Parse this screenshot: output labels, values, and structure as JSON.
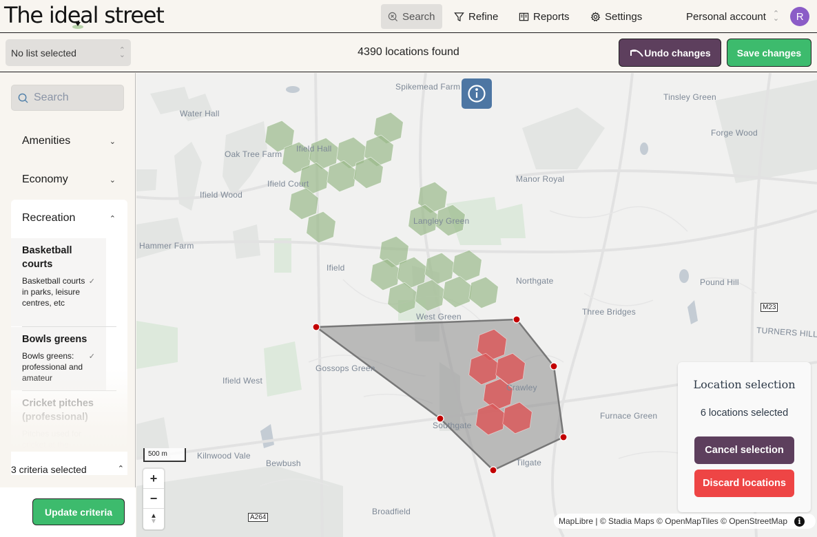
{
  "app": {
    "title": "The ideal street",
    "nav": [
      {
        "label": "Search",
        "icon": "search-x-icon",
        "active": true
      },
      {
        "label": "Refine",
        "icon": "filter-icon",
        "active": false
      },
      {
        "label": "Reports",
        "icon": "book-icon",
        "active": false
      },
      {
        "label": "Settings",
        "icon": "gear-icon",
        "active": false
      }
    ],
    "account": {
      "label": "Personal account",
      "avatar_letter": "R",
      "avatar_color": "#8b5cc7"
    }
  },
  "toolbar": {
    "list_select": "No list selected",
    "locations_found": "4390 locations found",
    "undo_label": "Undo changes",
    "save_label": "Save changes"
  },
  "sidebar": {
    "search_placeholder": "Search",
    "categories": [
      {
        "label": "Amenities",
        "expanded": false
      },
      {
        "label": "Economy",
        "expanded": false
      },
      {
        "label": "Recreation",
        "expanded": true
      }
    ],
    "criteria": [
      {
        "title": "Basketball courts",
        "description": "Basketball courts in parks, leisure centres, etc",
        "selected": true
      },
      {
        "title": "Bowls greens",
        "description": "Bowls greens: professional and amateur",
        "selected": true
      },
      {
        "title": "Cricket pitches (professional)",
        "description": "Pitches used for cricket at the",
        "selected": false
      }
    ],
    "criteria_count": "3 criteria selected",
    "update_label": "Update criteria"
  },
  "map": {
    "places": [
      {
        "name": "Spikemead Farm"
      },
      {
        "name": "Tinsley Green"
      },
      {
        "name": "Water Hall"
      },
      {
        "name": "Forge Wood"
      },
      {
        "name": "Oak Tree Farm"
      },
      {
        "name": "Ifield Hall"
      },
      {
        "name": "Manor Royal"
      },
      {
        "name": "Ifield Court"
      },
      {
        "name": "Ifield Wood"
      },
      {
        "name": "Langley Green"
      },
      {
        "name": "Hammer Farm"
      },
      {
        "name": "Ifield"
      },
      {
        "name": "Northgate"
      },
      {
        "name": "Pound Hill"
      },
      {
        "name": "Three Bridges"
      },
      {
        "name": "West Green"
      },
      {
        "name": "Gossops Green"
      },
      {
        "name": "Ifield West"
      },
      {
        "name": "Crawley"
      },
      {
        "name": "Southgate"
      },
      {
        "name": "Furnace Green"
      },
      {
        "name": "Tilgate"
      },
      {
        "name": "Bewbush"
      },
      {
        "name": "Kilnwood Vale"
      },
      {
        "name": "Broadfield"
      },
      {
        "name": "TURNERS HILL R"
      }
    ],
    "road_labels": [
      "M23",
      "A264"
    ],
    "scale": "500 m",
    "zoom_in": "+",
    "zoom_out": "−",
    "compass": "▲",
    "attribution": "MapLibre | © Stadia Maps © OpenMapTiles © OpenStreetMap",
    "colors": {
      "result_hex": "#9ab98a",
      "selected_hex": "#d9595a",
      "polygon_fill": "#8c8c8c",
      "vertex": "#c20000"
    }
  },
  "selection_panel": {
    "title": "Location selection",
    "count": "6 locations selected",
    "cancel_label": "Cancel selection",
    "discard_label": "Discard locations"
  }
}
